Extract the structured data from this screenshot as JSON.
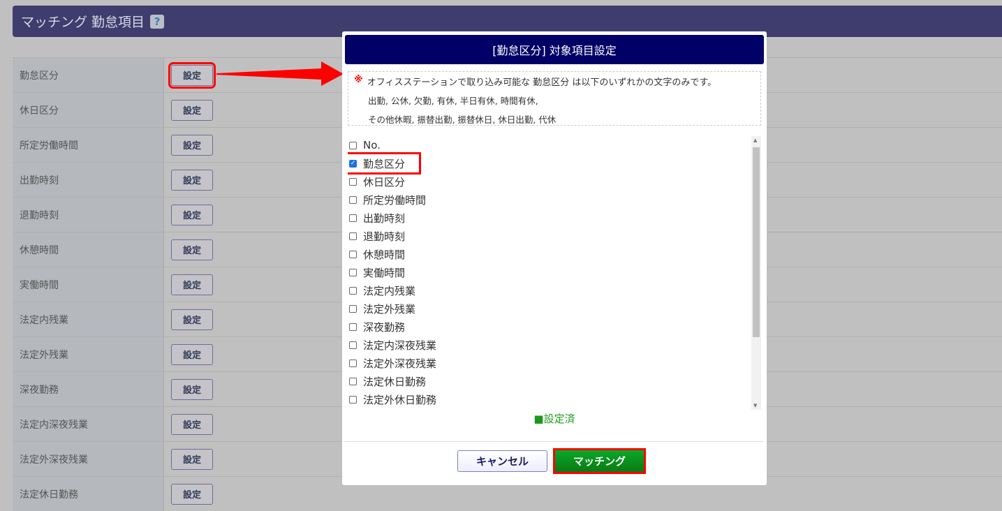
{
  "page": {
    "title": "マッチング 勤怠項目",
    "help": "?"
  },
  "rows": [
    "勤怠区分",
    "休日区分",
    "所定労働時間",
    "出勤時刻",
    "退勤時刻",
    "休憩時間",
    "実働時間",
    "法定内残業",
    "法定外残業",
    "深夜勤務",
    "法定内深夜残業",
    "法定外深夜残業",
    "法定休日勤務"
  ],
  "set_label": "設定",
  "modal": {
    "title": "[勤怠区分] 対象項目設定",
    "note_mark": "※",
    "note": "オフィスステーションで取り込み可能な 勤怠区分 は以下のいずれかの文字のみです。",
    "note_line1": "出勤, 公休, 欠勤, 有休, 半日有休, 時間有休,",
    "note_line2": "その他休暇, 振替出勤, 振替休日, 休日出勤, 代休",
    "items": [
      {
        "label": "No.",
        "checked": false
      },
      {
        "label": "勤怠区分",
        "checked": true
      },
      {
        "label": "休日区分",
        "checked": false
      },
      {
        "label": "所定労働時間",
        "checked": false
      },
      {
        "label": "出勤時刻",
        "checked": false
      },
      {
        "label": "退勤時刻",
        "checked": false
      },
      {
        "label": "休憩時間",
        "checked": false
      },
      {
        "label": "実働時間",
        "checked": false
      },
      {
        "label": "法定内残業",
        "checked": false
      },
      {
        "label": "法定外残業",
        "checked": false
      },
      {
        "label": "深夜勤務",
        "checked": false
      },
      {
        "label": "法定内深夜残業",
        "checked": false
      },
      {
        "label": "法定外深夜残業",
        "checked": false
      },
      {
        "label": "法定休日勤務",
        "checked": false
      },
      {
        "label": "法定外休日勤務",
        "checked": false
      }
    ],
    "status": "■設定済",
    "cancel": "キャンセル",
    "match": "マッチング"
  },
  "colors": {
    "header": "#3f3d6e",
    "modal_title": "#000066",
    "accent": "#ff0000",
    "ok": "#0b8a1e"
  }
}
